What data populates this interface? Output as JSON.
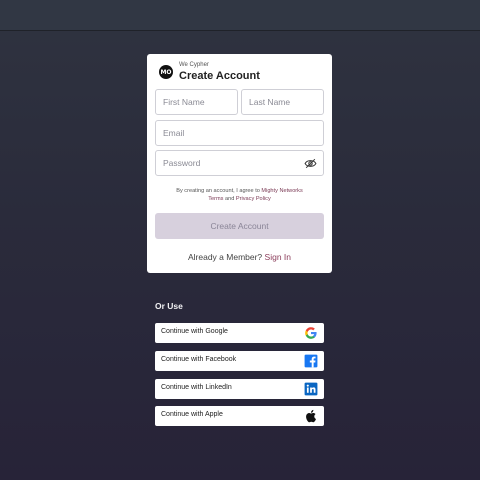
{
  "card": {
    "logo_text": "MO",
    "network_name": "We Cypher",
    "title": "Create Account"
  },
  "form": {
    "first_name_placeholder": "First Name",
    "last_name_placeholder": "Last Name",
    "email_placeholder": "Email",
    "password_placeholder": "Password",
    "password_toggle_icon": "eye-slash-icon"
  },
  "terms": {
    "prefix": "By creating an account, I agree to ",
    "network_link": "Mighty Networks",
    "terms_link": "Terms",
    "and": " and ",
    "privacy_link": "Privacy Policy"
  },
  "submit": {
    "label": "Create Account",
    "disabled_bg": "#d7d0dd"
  },
  "signin": {
    "prompt": "Already a Member? ",
    "link": "Sign In",
    "link_color": "#8b3c5a"
  },
  "social": {
    "heading": "Or Use",
    "items": [
      {
        "label": "Continue with Google",
        "icon": "google-icon"
      },
      {
        "label": "Continue with Facebook",
        "icon": "facebook-icon"
      },
      {
        "label": "Continue with LinkedIn",
        "icon": "linkedin-icon"
      },
      {
        "label": "Continue with Apple",
        "icon": "apple-icon"
      }
    ]
  }
}
